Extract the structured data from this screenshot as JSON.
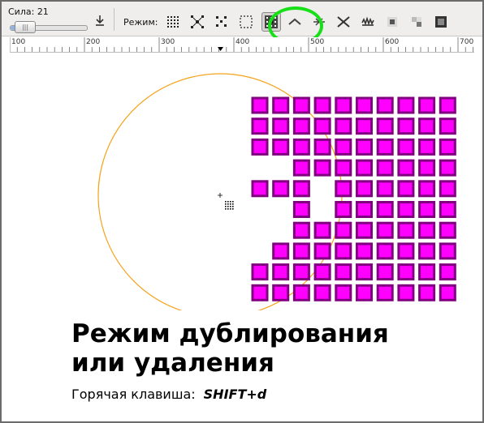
{
  "toolbar": {
    "force_label": "Сила:",
    "force_value": "21",
    "force_fraction": 0.21,
    "mode_label": "Режим:",
    "modes": [
      {
        "icon": "scatter-icon",
        "active": false
      },
      {
        "icon": "shrink-icon",
        "active": false
      },
      {
        "icon": "move-icon",
        "active": false
      },
      {
        "icon": "move-in-out-icon",
        "active": false
      },
      {
        "icon": "duplicate-delete-icon",
        "active": true
      },
      {
        "icon": "rotate-icon",
        "active": false
      },
      {
        "icon": "scale-icon",
        "active": false
      },
      {
        "icon": "path-shrink-icon",
        "active": false
      },
      {
        "icon": "roughen-icon",
        "active": false
      },
      {
        "icon": "paint-icon",
        "active": false
      },
      {
        "icon": "jitter-color-icon",
        "active": false
      },
      {
        "icon": "blur-icon",
        "active": false
      }
    ]
  },
  "ruler": {
    "labels": [
      "100",
      "200",
      "300",
      "400",
      "500",
      "600",
      "700"
    ]
  },
  "canvas": {
    "square_fill": "#ff00ff",
    "square_stroke": "#800080",
    "circle_color": "#f5a31a",
    "grid_rows": [
      [
        1,
        1,
        1,
        1,
        1,
        1,
        1,
        1,
        1,
        1
      ],
      [
        1,
        1,
        1,
        1,
        1,
        1,
        1,
        1,
        1,
        1
      ],
      [
        1,
        1,
        1,
        1,
        1,
        1,
        1,
        1,
        1,
        1
      ],
      [
        0,
        0,
        1,
        1,
        1,
        1,
        1,
        1,
        1,
        1
      ],
      [
        1,
        1,
        1,
        0,
        1,
        1,
        1,
        1,
        1,
        1
      ],
      [
        0,
        0,
        1,
        0,
        1,
        1,
        1,
        1,
        1,
        1
      ],
      [
        0,
        0,
        1,
        1,
        1,
        1,
        1,
        1,
        1,
        1
      ],
      [
        0,
        1,
        1,
        1,
        1,
        1,
        1,
        1,
        1,
        1
      ],
      [
        1,
        1,
        1,
        1,
        1,
        1,
        1,
        1,
        1,
        1
      ],
      [
        1,
        1,
        1,
        1,
        1,
        1,
        1,
        1,
        1,
        1
      ]
    ]
  },
  "caption": {
    "title_line1": "Режим дублирования",
    "title_line2": "или удаления",
    "hotkey_label": "Горячая клавиша:",
    "hotkey_value": "SHIFT+d"
  },
  "colors": {
    "highlight_ring": "#18e018"
  }
}
